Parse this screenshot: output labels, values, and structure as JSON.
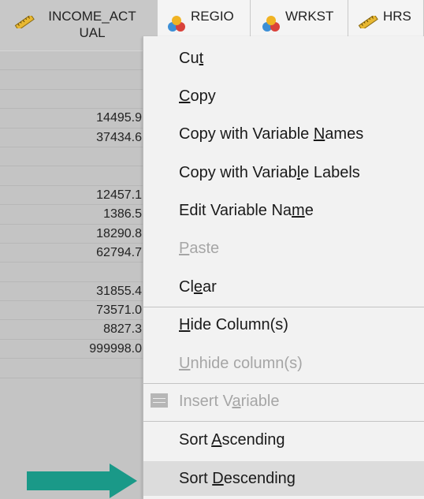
{
  "columns": [
    {
      "name": "INCOME_ACTUAL",
      "line1": "INCOME_ACT",
      "line2": "UAL",
      "icon": "ruler-icon"
    },
    {
      "name": "REGIO",
      "icon": "nominal-icon"
    },
    {
      "name": "WRKST",
      "icon": "nominal-icon"
    },
    {
      "name": "HRS",
      "icon": "ruler-icon"
    }
  ],
  "income_values": [
    "",
    "",
    "",
    "14495.9",
    "37434.6",
    "",
    "",
    "12457.1",
    "1386.5",
    "18290.8",
    "62794.7",
    "",
    "31855.4",
    "73571.0",
    "8827.3",
    "999998.0",
    ""
  ],
  "context_menu": {
    "items": [
      {
        "pre": "Cu",
        "u": "t",
        "post": "",
        "enabled": true
      },
      {
        "pre": "",
        "u": "C",
        "post": "opy",
        "enabled": true
      },
      {
        "pre": "Copy with Variable ",
        "u": "N",
        "post": "ames",
        "enabled": true
      },
      {
        "pre": "Copy with Variab",
        "u": "l",
        "post": "e Labels",
        "enabled": true
      },
      {
        "pre": "Edit Variable Na",
        "u": "m",
        "post": "e",
        "enabled": true
      },
      {
        "pre": "",
        "u": "P",
        "post": "aste",
        "enabled": false
      },
      {
        "pre": "Cl",
        "u": "e",
        "post": "ar",
        "enabled": true
      },
      {
        "pre": "",
        "u": "H",
        "post": "ide Column(s)",
        "enabled": true
      },
      {
        "pre": "",
        "u": "U",
        "post": "nhide column(s)",
        "enabled": false
      },
      {
        "pre": "Insert V",
        "u": "a",
        "post": "riable",
        "enabled": false,
        "icon": "insert-variable-icon"
      },
      {
        "pre": "Sort ",
        "u": "A",
        "post": "scending",
        "enabled": true
      },
      {
        "pre": "Sort ",
        "u": "D",
        "post": "escending",
        "enabled": true,
        "highlighted": true
      }
    ]
  },
  "colors": {
    "arrow": "#1a9988",
    "selected_column": "#c4c4c4",
    "menu_bg": "#f2f2f2",
    "disabled_text": "#a6a6a6"
  }
}
